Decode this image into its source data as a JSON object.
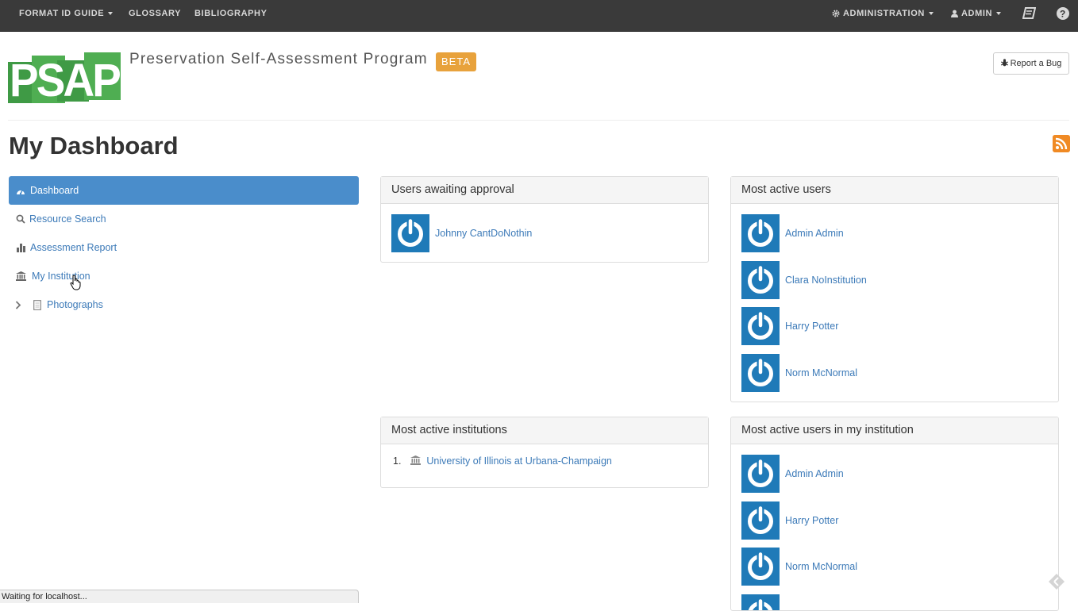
{
  "topnav": {
    "format_id_guide": "FORMAT ID GUIDE",
    "glossary": "GLOSSARY",
    "bibliography": "BIBLIOGRAPHY",
    "administration": "ADMINISTRATION",
    "admin": "ADMIN",
    "icons": [
      "gear-icon",
      "user-icon",
      "book-icon",
      "help-icon"
    ]
  },
  "header": {
    "logo_text": "PSAP",
    "site_title": "Preservation Self-Assessment Program",
    "beta": "BETA",
    "report_bug": "Report a Bug"
  },
  "page": {
    "title": "My Dashboard"
  },
  "sidebar": {
    "items": [
      {
        "label": "Dashboard",
        "icon": "dashboard-icon",
        "active": true
      },
      {
        "label": "Resource Search",
        "icon": "search-icon"
      },
      {
        "label": "Assessment Report",
        "icon": "bar-chart-icon"
      },
      {
        "label": "My Institution",
        "icon": "institution-icon"
      },
      {
        "label": "Photographs",
        "icon": "document-icon",
        "expander": "chevron-right-icon"
      }
    ]
  },
  "panels": {
    "awaiting": {
      "title": "Users awaiting approval",
      "users": [
        "Johnny CantDoNothin"
      ]
    },
    "active_users": {
      "title": "Most active users",
      "users": [
        "Admin Admin",
        "Clara NoInstitution",
        "Harry Potter",
        "Norm McNormal"
      ]
    },
    "institutions": {
      "title": "Most active institutions",
      "items": [
        {
          "num": "1.",
          "name": "University of Illinois at Urbana-Champaign"
        }
      ]
    },
    "my_institution": {
      "title": "Most active users in my institution",
      "users": [
        "Admin Admin",
        "Harry Potter",
        "Norm McNormal"
      ]
    }
  },
  "status": {
    "text": "Waiting for localhost..."
  },
  "colors": {
    "accent": "#4a8dcb",
    "link": "#3c7ab8",
    "beta": "#e8a23c",
    "avatar": "#1f7ab8",
    "navbar": "#3a3a3a",
    "logo_green": "#3f9a45"
  }
}
